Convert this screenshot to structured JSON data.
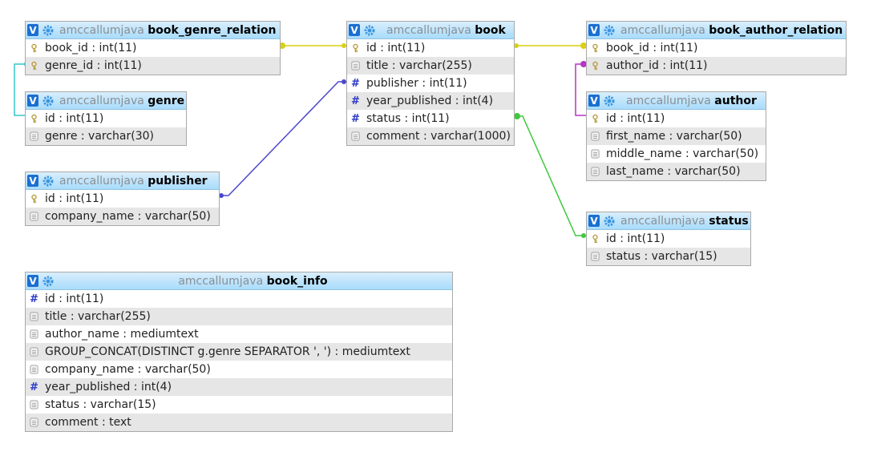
{
  "colors": {
    "header_gradient_top": "#d9eefc",
    "header_gradient_bottom": "#a8dcfc",
    "badge": "#1b6fd0",
    "link_yellow": "#d8d010",
    "link_cyan": "#36c6c8",
    "link_purple": "#b535c4",
    "link_blue": "#4b46cf",
    "link_green": "#3ec83e"
  },
  "tables": {
    "book_genre_relation": {
      "db": "amccallumjava",
      "name": "book_genre_relation",
      "columns": [
        {
          "text": "book_id : int(11)",
          "icon": "key"
        },
        {
          "text": "genre_id : int(11)",
          "icon": "key"
        }
      ]
    },
    "genre": {
      "db": "amccallumjava",
      "name": "genre",
      "columns": [
        {
          "text": "id : int(11)",
          "icon": "key"
        },
        {
          "text": "genre : varchar(30)",
          "icon": "text"
        }
      ]
    },
    "publisher": {
      "db": "amccallumjava",
      "name": "publisher",
      "columns": [
        {
          "text": "id : int(11)",
          "icon": "key"
        },
        {
          "text": "company_name : varchar(50)",
          "icon": "text"
        }
      ]
    },
    "book": {
      "db": "amccallumjava",
      "name": "book",
      "columns": [
        {
          "text": "id : int(11)",
          "icon": "key"
        },
        {
          "text": "title : varchar(255)",
          "icon": "text"
        },
        {
          "text": "publisher : int(11)",
          "icon": "hash"
        },
        {
          "text": "year_published : int(4)",
          "icon": "hash"
        },
        {
          "text": "status : int(11)",
          "icon": "hash"
        },
        {
          "text": "comment : varchar(1000)",
          "icon": "text"
        }
      ]
    },
    "book_author_relation": {
      "db": "amccallumjava",
      "name": "book_author_relation",
      "columns": [
        {
          "text": "book_id : int(11)",
          "icon": "key"
        },
        {
          "text": "author_id : int(11)",
          "icon": "key"
        }
      ]
    },
    "author": {
      "db": "amccallumjava",
      "name": "author",
      "columns": [
        {
          "text": "id : int(11)",
          "icon": "key"
        },
        {
          "text": "first_name : varchar(50)",
          "icon": "text"
        },
        {
          "text": "middle_name : varchar(50)",
          "icon": "text"
        },
        {
          "text": "last_name : varchar(50)",
          "icon": "text"
        }
      ]
    },
    "status": {
      "db": "amccallumjava",
      "name": "status",
      "columns": [
        {
          "text": "id : int(11)",
          "icon": "key"
        },
        {
          "text": "status : varchar(15)",
          "icon": "text"
        }
      ]
    },
    "book_info": {
      "db": "amccallumjava",
      "name": "book_info",
      "columns": [
        {
          "text": "id : int(11)",
          "icon": "hash"
        },
        {
          "text": "title : varchar(255)",
          "icon": "text"
        },
        {
          "text": "author_name : mediumtext",
          "icon": "text"
        },
        {
          "text": "GROUP_CONCAT(DISTINCT g.genre SEPARATOR ', ') : mediumtext",
          "icon": "text"
        },
        {
          "text": "company_name : varchar(50)",
          "icon": "text"
        },
        {
          "text": "year_published : int(4)",
          "icon": "hash"
        },
        {
          "text": "status : varchar(15)",
          "icon": "text"
        },
        {
          "text": "comment : text",
          "icon": "text"
        }
      ]
    }
  }
}
